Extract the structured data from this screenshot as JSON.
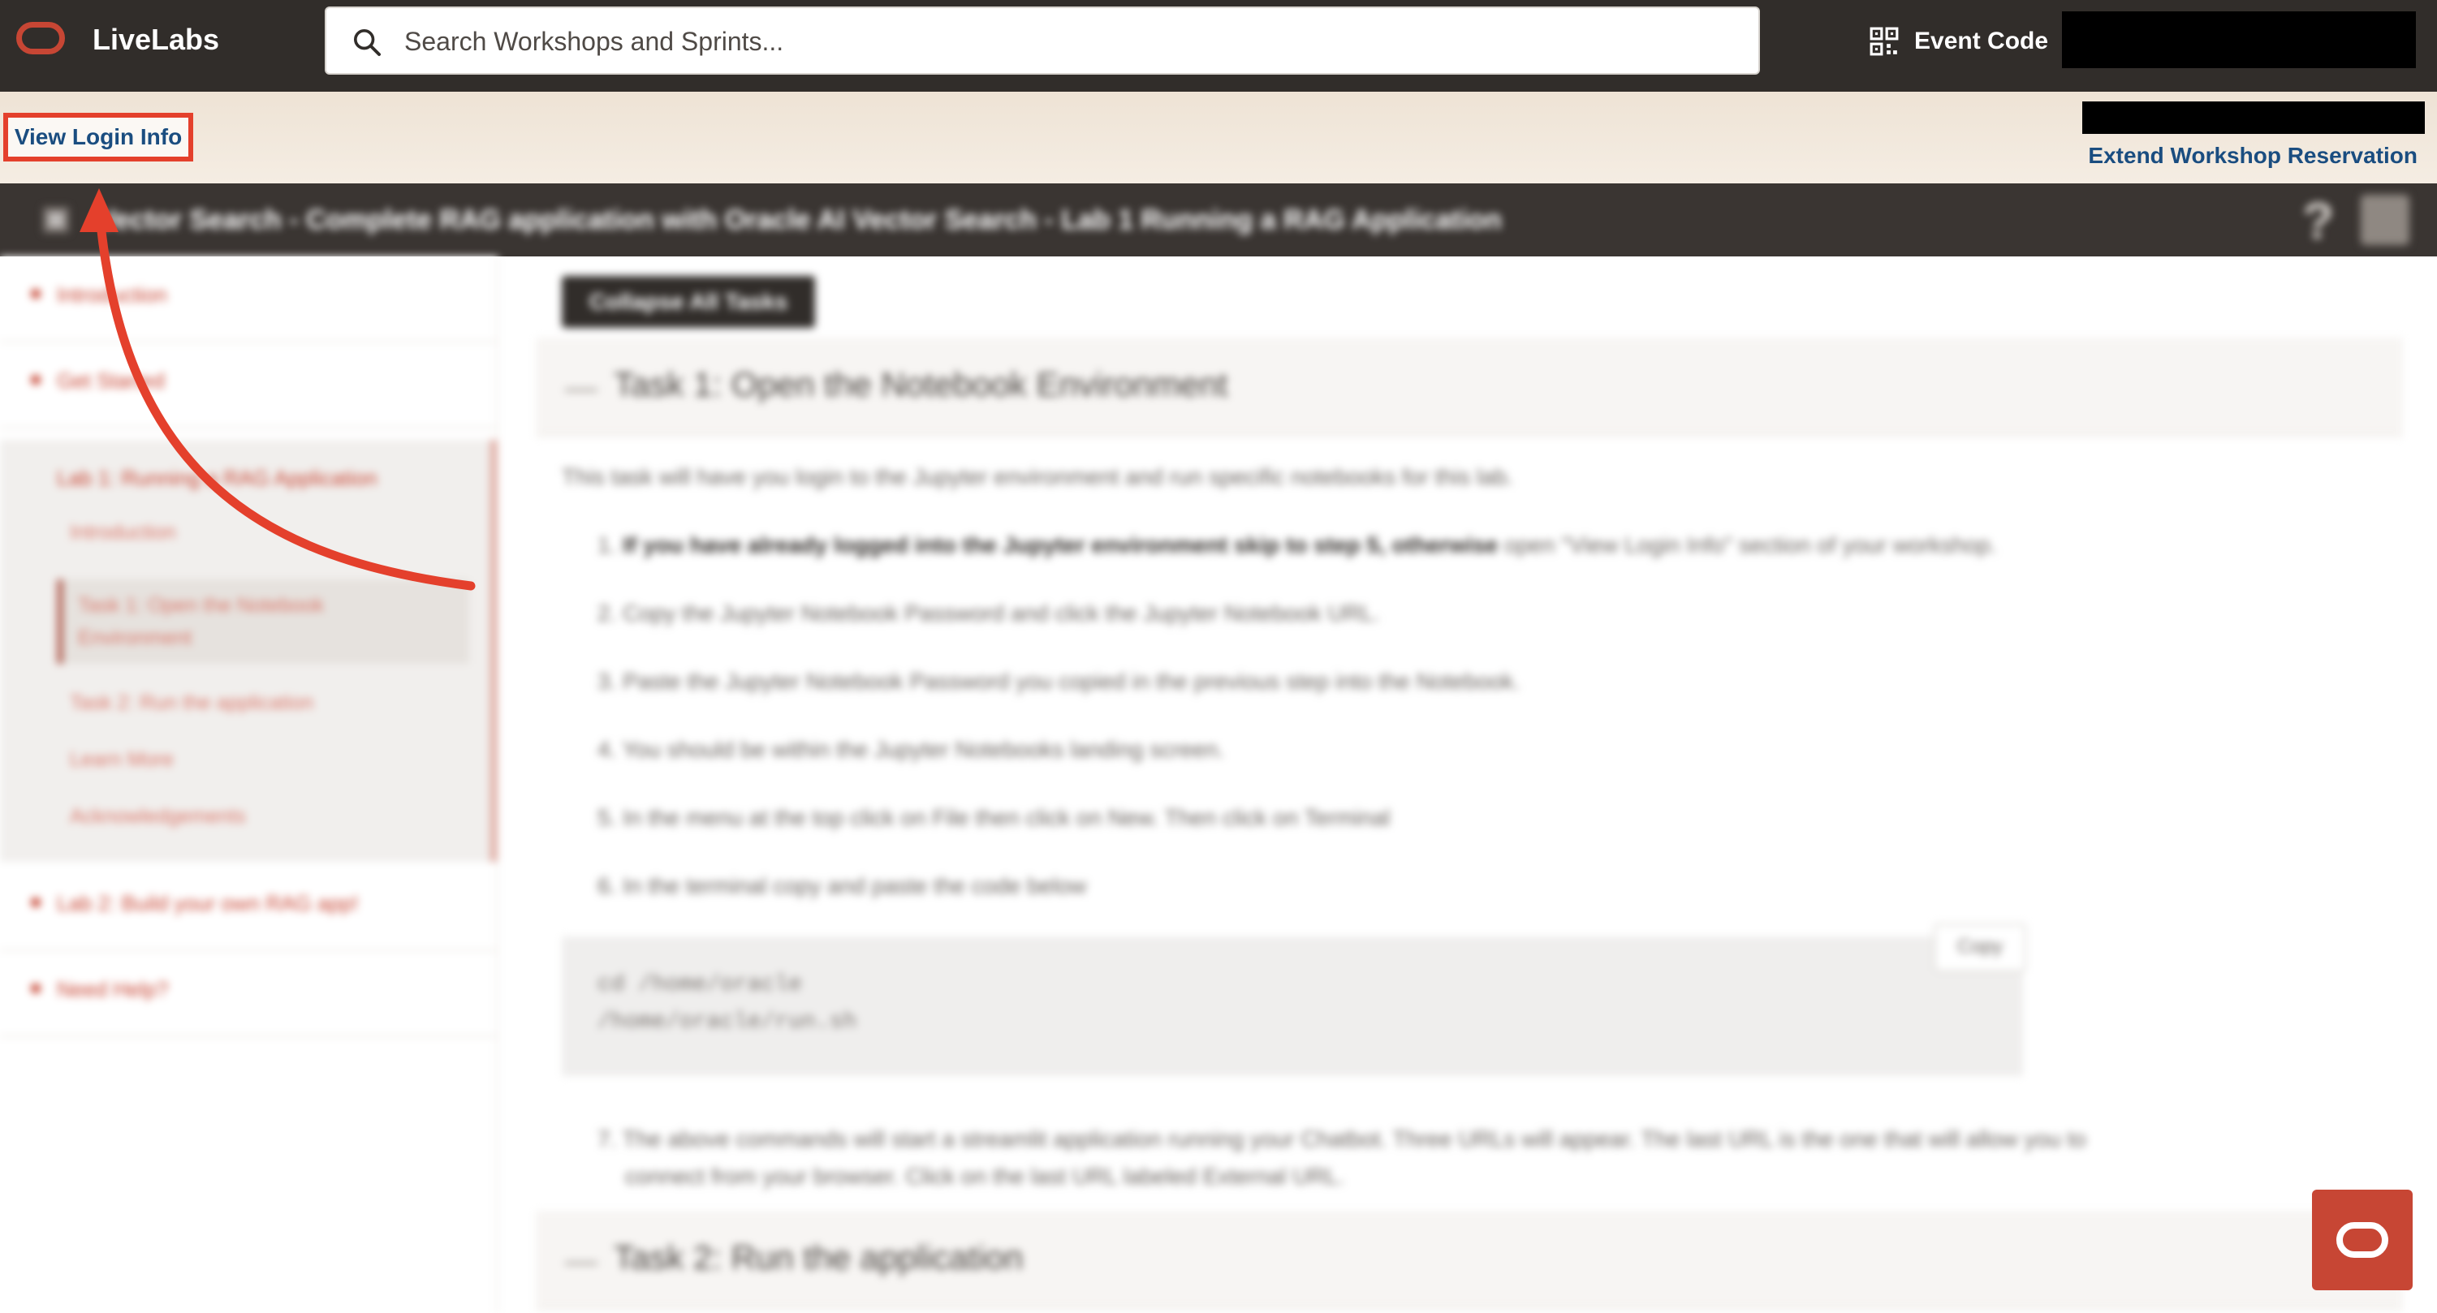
{
  "header": {
    "brand": "LiveLabs",
    "search_placeholder": "Search Workshops and Sprints...",
    "event_code_label": "Event Code"
  },
  "subheader": {
    "view_login_label": "View Login Info",
    "extend_label": "Extend Workshop Reservation"
  },
  "titlebar": {
    "title": "Vector Search - Complete RAG application with Oracle AI Vector Search - Lab 1 Running a RAG Application",
    "help_glyph": "?"
  },
  "sidebar": {
    "items_top": [
      "Introduction",
      "Get Started"
    ],
    "group_title": "Lab 1: Running a RAG Application",
    "group_items": [
      "Introduction",
      "Task 1: Open the Notebook Environment",
      "Task 2: Run the application",
      "Learn More",
      "Acknowledgements"
    ],
    "items_bottom": [
      "Lab 2: Build your own RAG app!",
      "Need Help?"
    ]
  },
  "content": {
    "collapse_label": "Collapse All Tasks",
    "task1_title": "Task 1: Open the Notebook Environment",
    "intro": "This task will have you login to the Jupyter environment and run specific notebooks for this lab.",
    "steps": [
      {
        "n": "1.",
        "bold": "If you have already logged into the Jupyter environment skip to step 5, otherwise",
        "rest": " open \"View Login Info\" section of your workshop."
      },
      {
        "n": "2.",
        "bold": "",
        "rest": "Copy the Jupyter Notebook Password and click the Jupyter Notebook URL."
      },
      {
        "n": "3.",
        "bold": "",
        "rest": "Paste the Jupyter Notebook Password you copied in the previous step into the Notebook."
      },
      {
        "n": "4.",
        "bold": "",
        "rest": "You should be within the Jupyter Notebooks landing screen."
      },
      {
        "n": "5.",
        "bold": "",
        "rest": "In the menu at the top click on File then click on New. Then click on Terminal"
      },
      {
        "n": "6.",
        "bold": "",
        "rest": "In the terminal copy and paste the code below"
      }
    ],
    "code_lines": [
      "cd /home/oracle",
      "/home/oracle/run.sh"
    ],
    "copy_label": "Copy",
    "step7_line1": "7. The above commands will start a streamlit application running your Chatbot. Three URLs will appear. The last URL is the one that will allow you to",
    "step7_line2": "connect from your browser. Click on the last URL labeled External URL.",
    "task2_title": "Task 2: Run the application"
  },
  "colors": {
    "brand_red": "#c74634",
    "topbar_bg": "#312d2a",
    "link_blue": "#1a4d80",
    "annotation_red": "#e4402c"
  },
  "icons": [
    "search-icon",
    "qr-code-icon",
    "menu-icon",
    "help-icon",
    "save-icon",
    "oracle-logo-icon",
    "annotation-arrow"
  ]
}
